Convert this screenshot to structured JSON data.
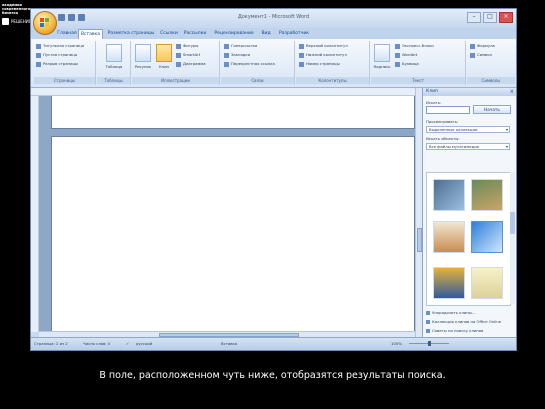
{
  "brand": {
    "line1": "академия",
    "line2": "современного",
    "line3": "бизнеса",
    "logo_text": "РЕШЕНИЯ"
  },
  "window": {
    "title": "Документ1 - Microsoft Word"
  },
  "tabs": [
    "Главная",
    "Вставка",
    "Разметка страницы",
    "Ссылки",
    "Рассылки",
    "Рецензирование",
    "Вид",
    "Разработчик"
  ],
  "active_tab": "Вставка",
  "ribbon": {
    "pages_group": {
      "label": "Страницы",
      "items": [
        "Титульная страница",
        "Пустая страница",
        "Разрыв страницы"
      ]
    },
    "tables_group": {
      "label": "Таблицы",
      "button": "Таблица"
    },
    "illustrations_group": {
      "label": "Иллюстрации",
      "buttons": [
        "Рисунок",
        "Клип"
      ],
      "items": [
        "Фигуры",
        "SmartArt",
        "Диаграмма"
      ]
    },
    "links_group": {
      "label": "Связи",
      "items": [
        "Гиперссылка",
        "Закладка",
        "Перекрестная ссылка"
      ]
    },
    "header_group": {
      "label": "Колонтитулы",
      "items": [
        "Верхний колонтитул",
        "Нижний колонтитул",
        "Номер страницы"
      ]
    },
    "text_group": {
      "label": "Текст",
      "items": [
        "Надпись",
        "Экспресс-блоки",
        "WordArt",
        "Буквица"
      ]
    },
    "symbols_group": {
      "label": "Символы",
      "items": [
        "Формула",
        "Символ"
      ]
    }
  },
  "clip_pane": {
    "title": "Клип",
    "search_label": "Искать:",
    "search_value": "",
    "search_button": "Начать",
    "scope_label": "Просматривать:",
    "scope_value": "Выделенные коллекции",
    "types_label": "Искать объекты:",
    "types_value": "Все файлы мультимедиа",
    "links": [
      "Упорядочить клипы...",
      "Коллекция клипов на Office Online",
      "Советы по поиску клипов"
    ]
  },
  "status": {
    "page": "Страница: 2 из 2",
    "words": "Число слов: 0",
    "language": "русский",
    "insert_mode": "Вставка",
    "zoom": "100%"
  },
  "subtitle": "В поле, расположенном чуть ниже, отобразятся результаты поиска.",
  "colors": {
    "ribbon": "#d8e5f5",
    "window": "#c9daf0",
    "accent": "#15428b",
    "office_button": "#f3b23a"
  }
}
